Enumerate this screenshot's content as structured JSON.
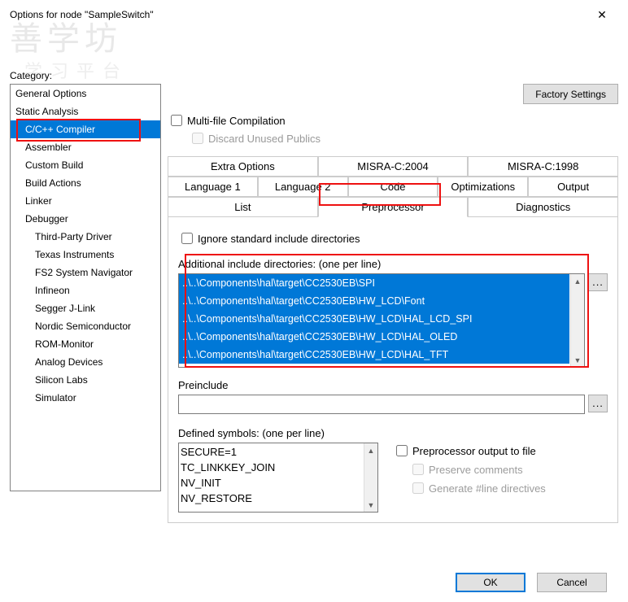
{
  "window": {
    "title": "Options for node \"SampleSwitch\"",
    "close": "✕"
  },
  "watermark": {
    "l1": "善学坊",
    "l2": "学习平台"
  },
  "category": {
    "label": "Category:",
    "items": [
      "General Options",
      "Static Analysis",
      "C/C++ Compiler",
      "Assembler",
      "Custom Build",
      "Build Actions",
      "Linker",
      "Debugger",
      "Third-Party Driver",
      "Texas Instruments",
      "FS2 System Navigator",
      "Infineon",
      "Segger J-Link",
      "Nordic Semiconductor",
      "ROM-Monitor",
      "Analog Devices",
      "Silicon Labs",
      "Simulator"
    ]
  },
  "right": {
    "factory": "Factory Settings",
    "multi": "Multi-file Compilation",
    "discard": "Discard Unused Publics",
    "tabs_row1": [
      "Extra Options",
      "MISRA-C:2004",
      "MISRA-C:1998"
    ],
    "tabs_row2": [
      "Language 1",
      "Language 2",
      "Code",
      "Optimizations",
      "Output"
    ],
    "tabs_row3": [
      "List",
      "Preprocessor",
      "Diagnostics"
    ],
    "ignore_std": "Ignore standard include directories",
    "add_inc_label": "Additional include directories: (one per line)",
    "include_dirs": [
      "..\\..\\Components\\hal\\target\\CC2530EB\\SPI",
      "..\\..\\Components\\hal\\target\\CC2530EB\\HW_LCD\\Font",
      "..\\..\\Components\\hal\\target\\CC2530EB\\HW_LCD\\HAL_LCD_SPI",
      "..\\..\\Components\\hal\\target\\CC2530EB\\HW_LCD\\HAL_OLED",
      "..\\..\\Components\\hal\\target\\CC2530EB\\HW_LCD\\HAL_TFT"
    ],
    "browse": "...",
    "preinc_label": "Preinclude",
    "defined_label": "Defined symbols: (one per line)",
    "defined": [
      "SECURE=1",
      "TC_LINKKEY_JOIN",
      "NV_INIT",
      "NV_RESTORE"
    ],
    "pp_out": "Preprocessor output to file",
    "pp_preserve": "Preserve comments",
    "pp_line": "Generate #line directives"
  },
  "buttons": {
    "ok": "OK",
    "cancel": "Cancel"
  }
}
